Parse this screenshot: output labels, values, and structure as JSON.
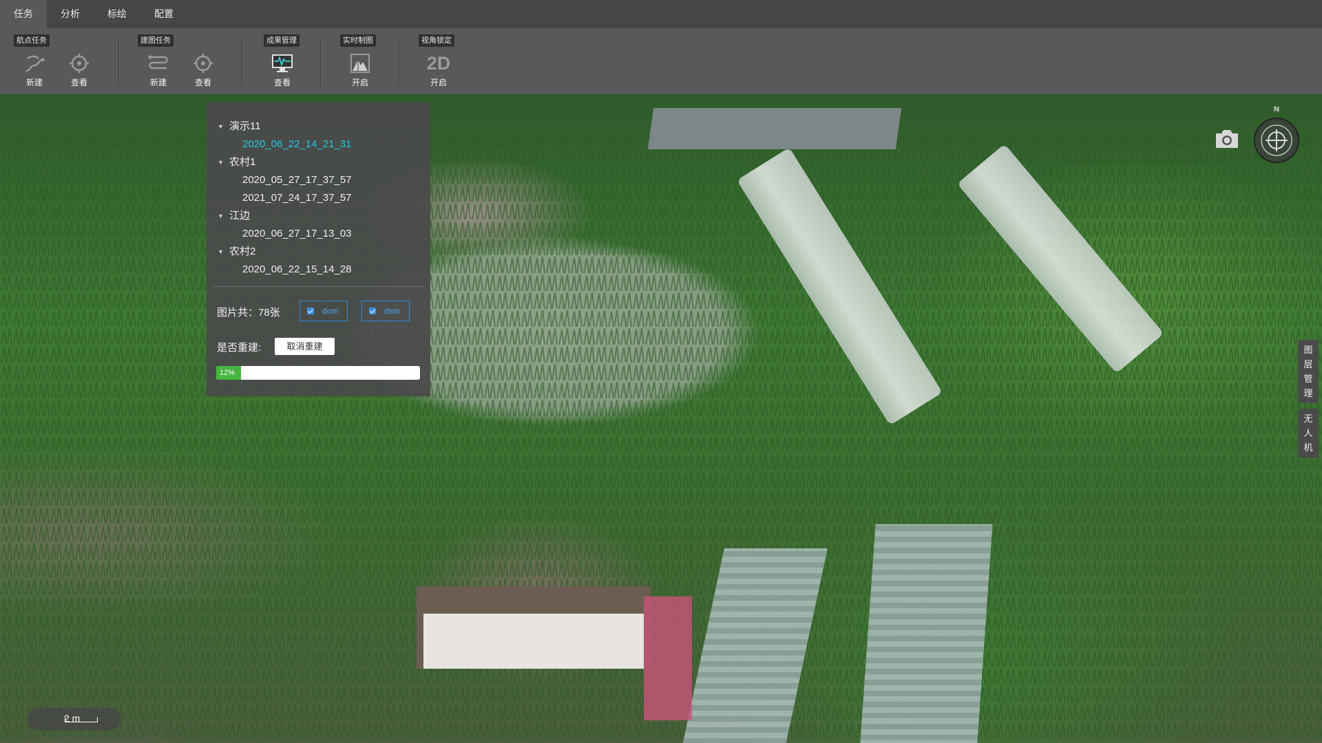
{
  "menubar": {
    "tabs": [
      {
        "label": "任务",
        "active": true
      },
      {
        "label": "分析"
      },
      {
        "label": "标绘"
      },
      {
        "label": "配置"
      }
    ]
  },
  "toolbar": {
    "groups": [
      {
        "label": "航点任务",
        "tools": [
          {
            "label": "新建",
            "icon": "route-new-icon"
          },
          {
            "label": "查看",
            "icon": "target-view-icon"
          }
        ]
      },
      {
        "label": "建图任务",
        "tools": [
          {
            "label": "新建",
            "icon": "mapping-new-icon"
          },
          {
            "label": "查看",
            "icon": "target-view-icon"
          }
        ]
      },
      {
        "label": "成果管理",
        "tools": [
          {
            "label": "查看",
            "icon": "monitor-chart-icon"
          }
        ]
      },
      {
        "label": "实时制图",
        "tools": [
          {
            "label": "开启",
            "icon": "mountain-image-icon"
          }
        ]
      },
      {
        "label": "视角锁定",
        "tools": [
          {
            "label": "开启",
            "icon": "2d-view-icon",
            "icon_text": "2D"
          }
        ]
      }
    ]
  },
  "task_panel": {
    "projects": [
      {
        "name": "演示11",
        "items": [
          "2020_06_22_14_21_31"
        ],
        "selected_index": 0
      },
      {
        "name": "农村1",
        "items": [
          "2020_05_27_17_37_57",
          "2021_07_24_17_37_57"
        ]
      },
      {
        "name": "江边",
        "items": [
          "2020_06_27_17_13_03"
        ]
      },
      {
        "name": "农村2",
        "items": [
          "2020_06_22_15_14_28"
        ]
      }
    ],
    "image_count_label": "图片共：78张",
    "checkboxes": [
      {
        "label": "dom",
        "checked": true
      },
      {
        "label": "dsm",
        "checked": true
      }
    ],
    "rebuild_label": "是否重建:",
    "cancel_rebuild_label": "取消重建",
    "progress": {
      "value": 0.12,
      "label": "12%"
    },
    "progress_color": "#45b53e"
  },
  "map": {
    "compass_north": "N",
    "side_tabs": [
      {
        "label": "图层管理"
      },
      {
        "label": "无人机"
      }
    ],
    "scale_label": "2 m"
  },
  "colors": {
    "accent": "#24c6e6",
    "checkbox": "#2d8bd8"
  }
}
